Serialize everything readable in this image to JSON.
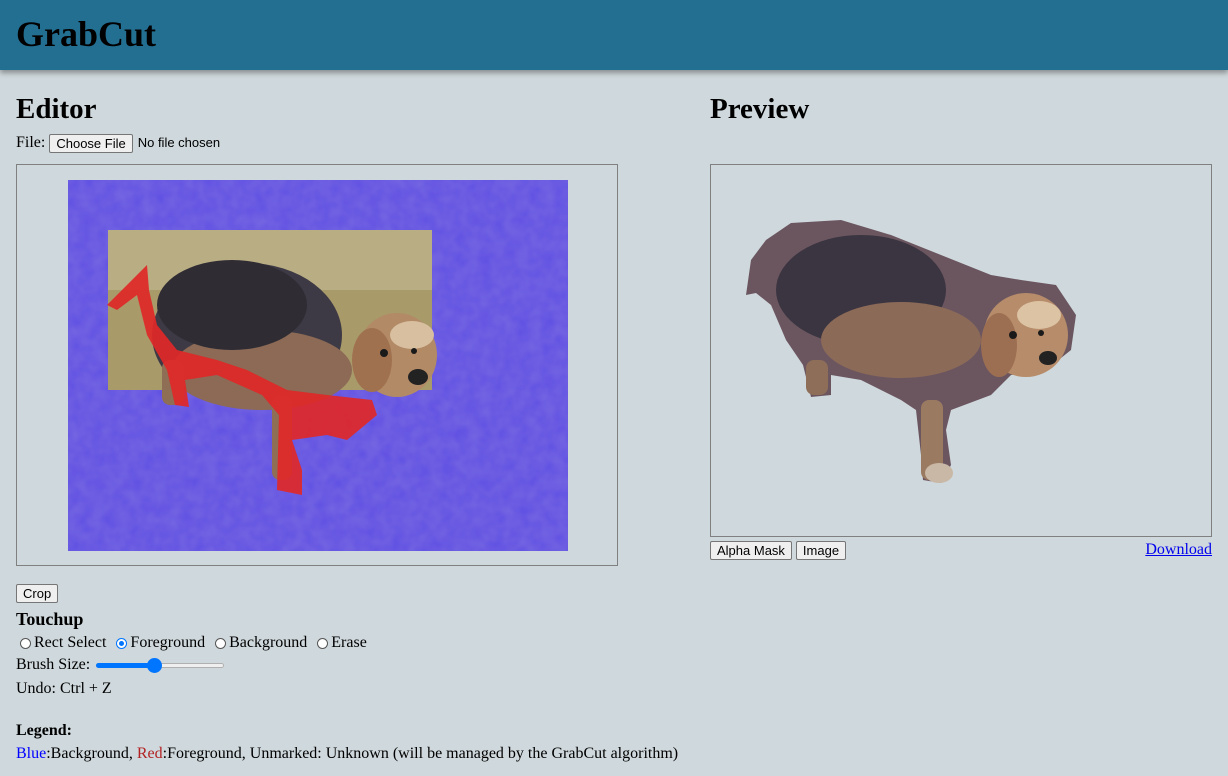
{
  "app": {
    "title": "GrabCut"
  },
  "editor": {
    "heading": "Editor",
    "file_label": "File:",
    "choose_file_label": "Choose File",
    "no_file_text": "No file chosen"
  },
  "preview": {
    "heading": "Preview",
    "alpha_mask_label": "Alpha Mask",
    "image_label": "Image",
    "download_label": "Download"
  },
  "tools": {
    "crop_label": "Crop",
    "touchup_heading": "Touchup",
    "modes": [
      {
        "label": "Rect Select",
        "checked": false
      },
      {
        "label": "Foreground",
        "checked": true
      },
      {
        "label": "Background",
        "checked": false
      },
      {
        "label": "Erase",
        "checked": false
      }
    ],
    "brush_label": "Brush Size:",
    "brush_value_fraction": 0.45,
    "undo_text": "Undo: Ctrl + Z"
  },
  "legend": {
    "heading": "Legend:",
    "blue_word": "Blue",
    "bg_text": ":Background, ",
    "red_word": "Red",
    "fg_text": ":Foreground, Unmarked: Unknown (will be managed by the GrabCut algorithm)"
  },
  "colors": {
    "header_bg": "#236f92",
    "page_bg": "#cfd8dc",
    "background_mark": "#5a48e0",
    "foreground_mark": "#e02828",
    "accent": "#0075ff"
  }
}
